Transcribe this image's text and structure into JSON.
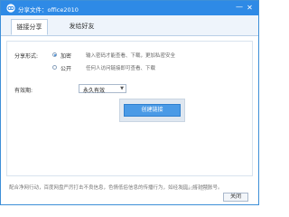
{
  "window": {
    "title": "分享文件：office2010",
    "minimize_glyph": "—",
    "close_glyph": "✕"
  },
  "tabs": [
    {
      "label": "链接分享",
      "active": true
    },
    {
      "label": "发给好友",
      "active": false
    }
  ],
  "share_form": {
    "method_label": "分享形式:",
    "options": [
      {
        "label": "加密",
        "desc": "输入密码才能查看、下载，更加私密安全",
        "selected": true
      },
      {
        "label": "公开",
        "desc": "任何人访问链接即可查看、下载",
        "selected": false
      }
    ],
    "validity_label": "有效期:",
    "validity_value": "永久有效",
    "create_button": "创建链接"
  },
  "footer": {
    "note": "配合净网行动，百度网盘严厉打击不良信息，色情低俗信息的传播行为，如经发现，将封禁账号。",
    "watermark": "Baidu 经验",
    "close_button": "关闭"
  },
  "colors": {
    "titlebar": "#2e8ae6",
    "accent": "#4a9ae6"
  },
  "icons": {
    "app": "cloud-icon",
    "minimize": "minimize-icon",
    "close": "close-icon",
    "dropdown": "chevron-down-icon"
  }
}
